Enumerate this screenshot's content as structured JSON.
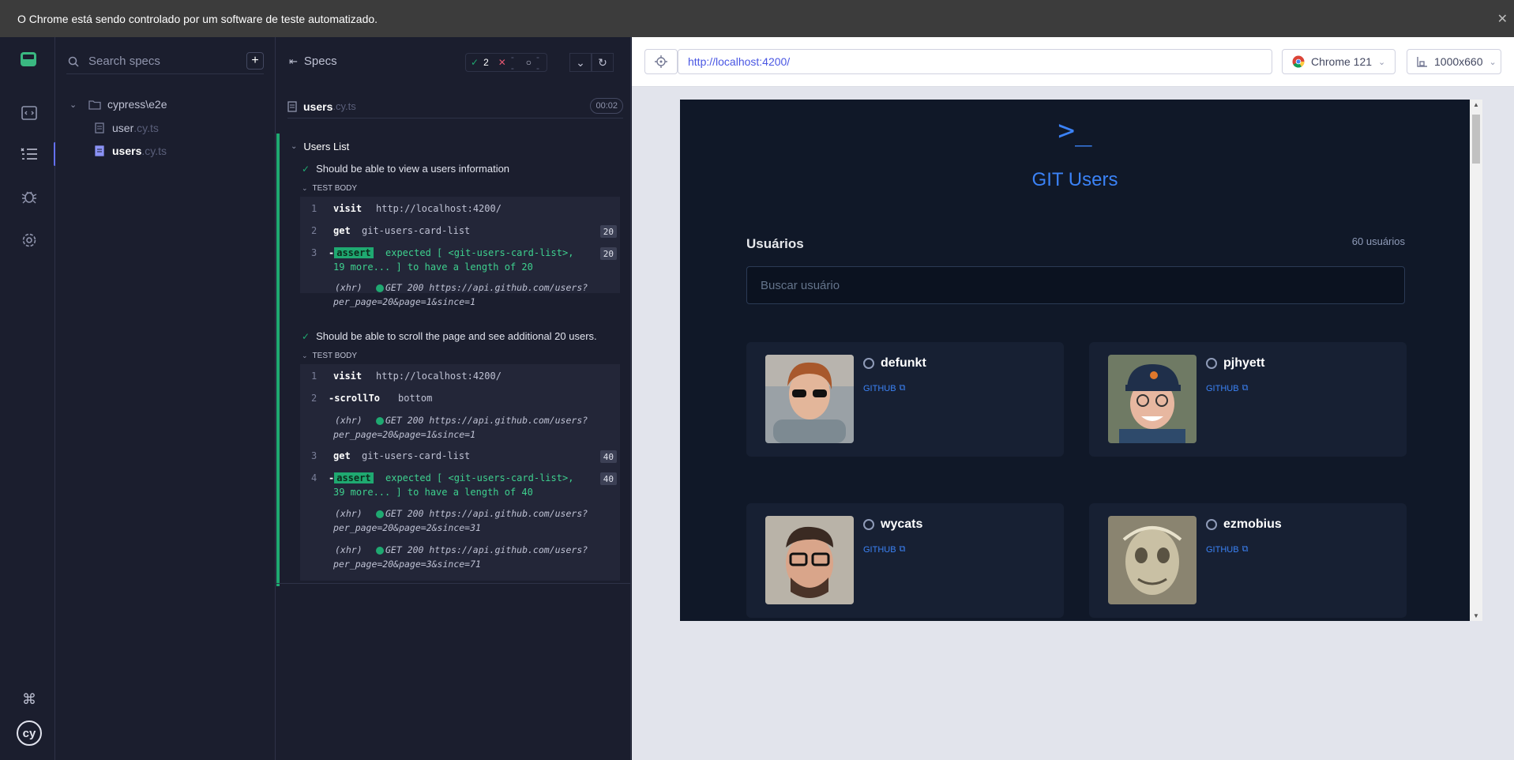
{
  "banner": {
    "text": "O Chrome está sendo controlado por um software de teste automatizado.",
    "close": "✕"
  },
  "specs": {
    "search_placeholder": "Search specs",
    "add": "+",
    "folder": "cypress\\e2e",
    "files": [
      {
        "name": "user",
        "ext": ".cy.ts"
      },
      {
        "name": "users",
        "ext": ".cy.ts"
      }
    ]
  },
  "reporter": {
    "title": "Specs",
    "passed": "2",
    "failed": "--",
    "pending": "--",
    "spec_name": "users",
    "spec_ext": ".cy.ts",
    "duration": "00:02",
    "suite": "Users List",
    "tests": [
      {
        "title": "Should be able to view a users information",
        "body_label": "TEST BODY",
        "commands": [
          {
            "num": "1",
            "name": "visit",
            "message": "http://localhost:4200/"
          },
          {
            "num": "2",
            "name": "get",
            "message": "git-users-card-list",
            "badge": "20"
          },
          {
            "num": "3",
            "name": "assert",
            "line1": "expected [ <git-users-card-list>,",
            "line2": "19 more... ] to have a length of 20",
            "badge": "20"
          }
        ],
        "xhr": [
          {
            "label": "(xhr)",
            "line1": "GET 200 https://api.github.com/users?",
            "line2": "per_page=20&page=1&since=1"
          }
        ]
      },
      {
        "title": "Should be able to scroll the page and see additional 20 users.",
        "body_label": "TEST BODY",
        "commands": [
          {
            "num": "1",
            "name": "visit",
            "message": "http://localhost:4200/"
          },
          {
            "num": "2",
            "name": "-scrollTo",
            "message": "bottom"
          },
          {
            "num": "3",
            "name": "get",
            "message": "git-users-card-list",
            "badge": "40"
          },
          {
            "num": "4",
            "name": "assert",
            "line1": "expected [ <git-users-card-list>,",
            "line2": "39 more... ] to have a length of 40",
            "badge": "40"
          }
        ],
        "xhr": [
          {
            "label": "(xhr)",
            "line1": "GET 200 https://api.github.com/users?",
            "line2": "per_page=20&page=1&since=1"
          },
          {
            "label": "(xhr)",
            "line1": "GET 200 https://api.github.com/users?",
            "line2": "per_page=20&page=2&since=31"
          },
          {
            "label": "(xhr)",
            "line1": "GET 200 https://api.github.com/users?",
            "line2": "per_page=20&page=3&since=71"
          }
        ]
      }
    ]
  },
  "browser": {
    "url": "http://localhost:4200/",
    "browser_name": "Chrome 121",
    "viewport": "1000x660"
  },
  "app": {
    "logo_glyph": ">_",
    "title": "GIT Users",
    "section": "Usuários",
    "count": "60 usuários",
    "search_placeholder": "Buscar usuário",
    "link_label": "GITHUB",
    "users": [
      {
        "login": "defunkt"
      },
      {
        "login": "pjhyett"
      },
      {
        "login": "wycats"
      },
      {
        "login": "ezmobius"
      }
    ]
  },
  "colors": {
    "accent": "#3b82f6",
    "pass": "#1fa971",
    "app_bg": "#101828",
    "card_bg": "#172033"
  }
}
